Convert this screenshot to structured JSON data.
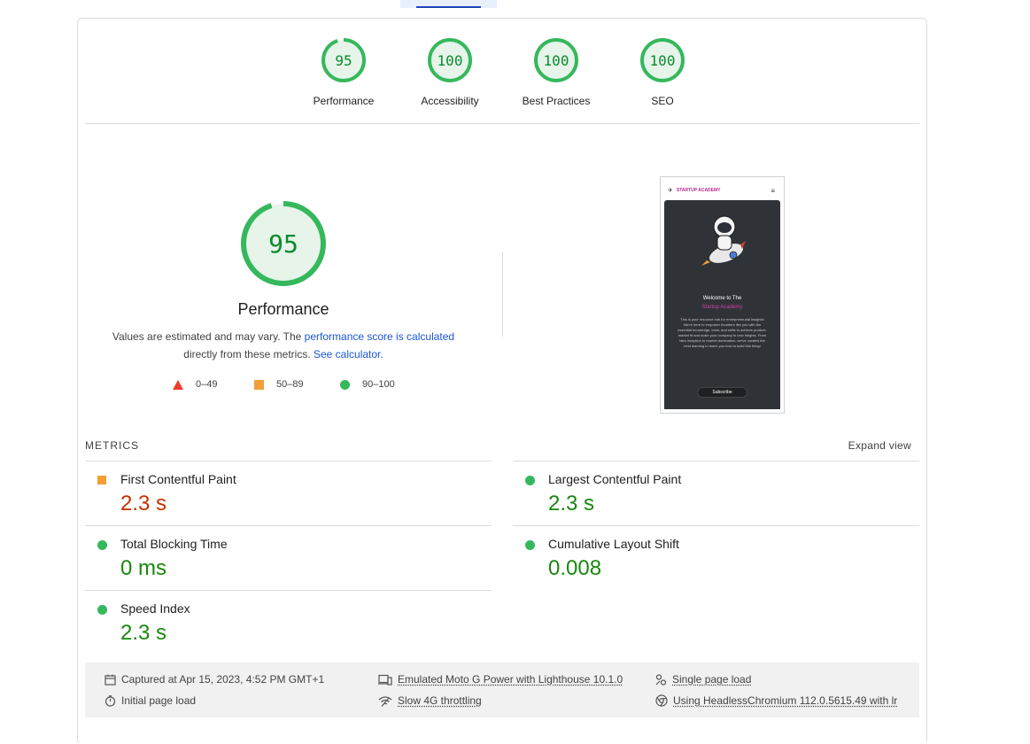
{
  "categories": [
    {
      "score": "95",
      "label": "Performance",
      "fraction": 0.95
    },
    {
      "score": "100",
      "label": "Accessibility",
      "fraction": 1.0
    },
    {
      "score": "100",
      "label": "Best Practices",
      "fraction": 1.0
    },
    {
      "score": "100",
      "label": "SEO",
      "fraction": 1.0
    }
  ],
  "performance": {
    "score": "95",
    "title": "Performance",
    "desc_prefix": "Values are estimated and may vary. The ",
    "desc_link": "performance score is calculated",
    "desc_middle": "directly from these metrics.",
    "desc_link2": "See calculator."
  },
  "legend": {
    "fail": "0–49",
    "average": "50–89",
    "pass": "90–100"
  },
  "screenshot": {
    "logo": "STARTUP ACADEMY",
    "welcome": "Welcome to The",
    "brand": "Startup Academy",
    "body": "This is your resource hub for entrepreneurial insights! We're here to empower founders like you with the essential knowledge, tools, and skills to achieve product-market fit and scale your company to new heights. From idea inception to market domination, we've curated the best learning to teach you how to build this thing!",
    "button": "Subscribe"
  },
  "metrics": {
    "heading": "METRICS",
    "expand": "Expand view",
    "items": [
      {
        "title": "First Contentful Paint",
        "value": "2.3 s",
        "status": "average"
      },
      {
        "title": "Largest Contentful Paint",
        "value": "2.3 s",
        "status": "pass"
      },
      {
        "title": "Total Blocking Time",
        "value": "0 ms",
        "status": "pass"
      },
      {
        "title": "Cumulative Layout Shift",
        "value": "0.008",
        "status": "pass"
      },
      {
        "title": "Speed Index",
        "value": "2.3 s",
        "status": "pass"
      }
    ]
  },
  "environment": {
    "captured": "Captured at Apr 15, 2023, 4:52 PM GMT+1",
    "device": "Emulated Moto G Power with Lighthouse 10.1.0",
    "load": "Single page load",
    "initial": "Initial page load",
    "throttling": "Slow 4G throttling",
    "browser": "Using HeadlessChromium 112.0.5615.49 with lr"
  },
  "colors": {
    "pass": "#35b85c",
    "average": "#f0a035",
    "fail": "#eb3c2c",
    "pass_text": "#19870e",
    "average_text": "#c33300"
  }
}
